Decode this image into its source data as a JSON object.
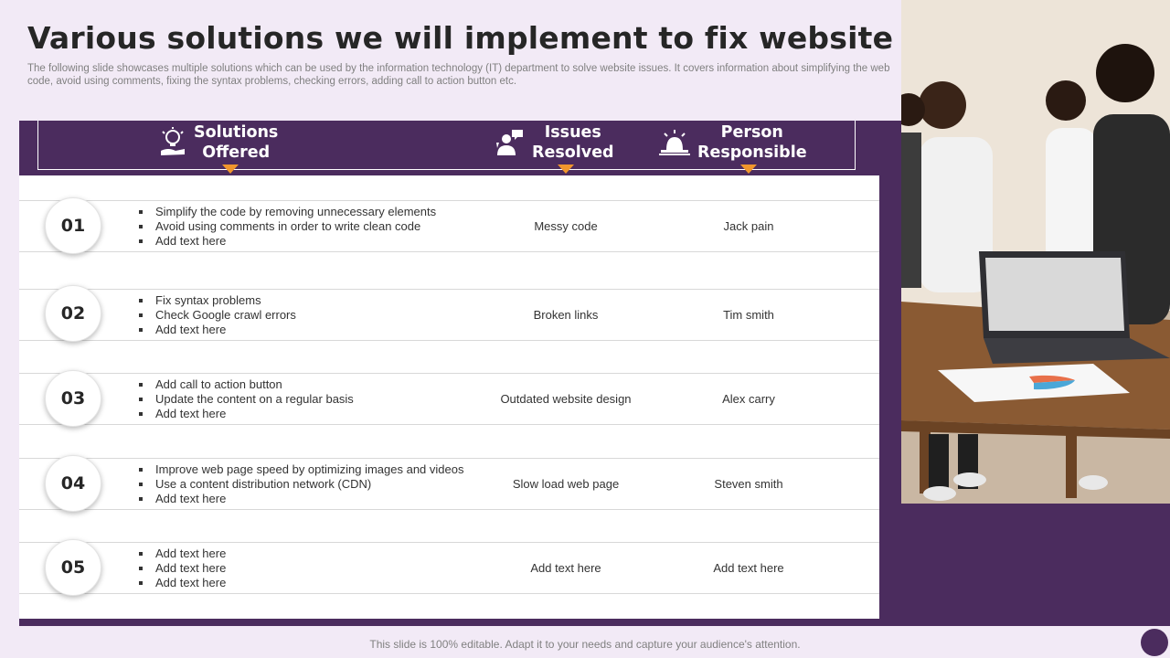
{
  "slide": {
    "title": "Various solutions we will implement to fix website issues",
    "subtitle": "The following slide showcases multiple solutions which can be used by the information technology (IT) department to solve website issues. It covers information about simplifying the web code, avoid using comments, fixing the syntax problems, checking errors, adding call to action button etc.",
    "footer": "This slide is 100% editable. Adapt it to your needs and capture your audience's attention."
  },
  "headers": {
    "solutions_line1": "Solutions",
    "solutions_line2": "Offered",
    "issues_line1": "Issues",
    "issues_line2": "Resolved",
    "person_line1": "Person",
    "person_line2": "Responsible"
  },
  "rows": [
    {
      "num": "01",
      "bullets": [
        "Simplify the code by removing  unnecessary elements",
        "Avoid using comments in order to write clean code",
        "Add text here"
      ],
      "issue": "Messy code",
      "person": "Jack pain"
    },
    {
      "num": "02",
      "bullets": [
        "Fix syntax problems",
        "Check Google  crawl errors",
        "Add text here"
      ],
      "issue": "Broken links",
      "person": "Tim smith"
    },
    {
      "num": "03",
      "bullets": [
        "Add call to action button",
        "Update the content on a regular basis",
        "Add text here"
      ],
      "issue": "Outdated website design",
      "person": "Alex carry"
    },
    {
      "num": "04",
      "bullets": [
        "Improve  web page speed by optimizing images and videos",
        "Use a content distribution network (CDN)",
        "Add text here"
      ],
      "issue": "Slow load web page",
      "person": "Steven smith"
    },
    {
      "num": "05",
      "bullets": [
        "Add text here",
        "Add text here",
        "Add text here"
      ],
      "issue": "Add text here",
      "person": "Add text here"
    }
  ],
  "colors": {
    "accent_purple": "#4b2c5e",
    "arrow_orange": "#f0962c",
    "background": "#f2eaf6"
  },
  "icons": {
    "solutions": "lightbulb-hand-icon",
    "issues": "person-speech-icon",
    "person": "alarm-desk-icon"
  }
}
